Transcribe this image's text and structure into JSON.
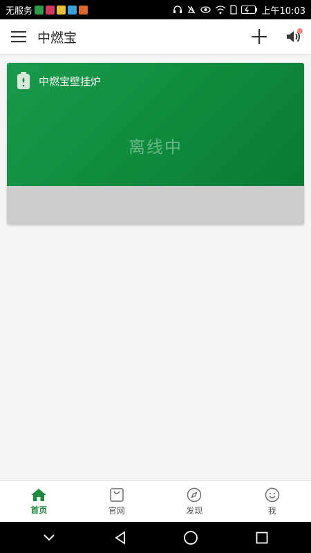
{
  "status_bar": {
    "carrier": "无服务",
    "time": "上午10:03",
    "app_icons": [
      {
        "name": "app-icon-1",
        "color": "#2e9a4c"
      },
      {
        "name": "app-icon-2",
        "color": "#d33a5a"
      },
      {
        "name": "app-icon-3",
        "color": "#e8c13a"
      },
      {
        "name": "app-icon-4",
        "color": "#3aa0d8"
      },
      {
        "name": "app-icon-5",
        "color": "#e0672a"
      }
    ]
  },
  "header": {
    "title": "中燃宝",
    "menu_icon": "menu-icon",
    "add_icon": "plus-icon",
    "sound_icon": "speaker-icon"
  },
  "device_card": {
    "name": "中燃宝壁挂炉",
    "status": "离线中",
    "colors": {
      "top": "#13913f",
      "bottom": "#cdcbcd"
    }
  },
  "bottom_nav": {
    "tabs": [
      {
        "label": "首页",
        "icon": "home-icon",
        "active": true
      },
      {
        "label": "官网",
        "icon": "shopping-bag-icon",
        "active": false
      },
      {
        "label": "发现",
        "icon": "compass-icon",
        "active": false
      },
      {
        "label": "我",
        "icon": "smiley-icon",
        "active": false
      }
    ]
  },
  "colors": {
    "accent": "#1e8a3e",
    "badge": "#f0897f"
  }
}
